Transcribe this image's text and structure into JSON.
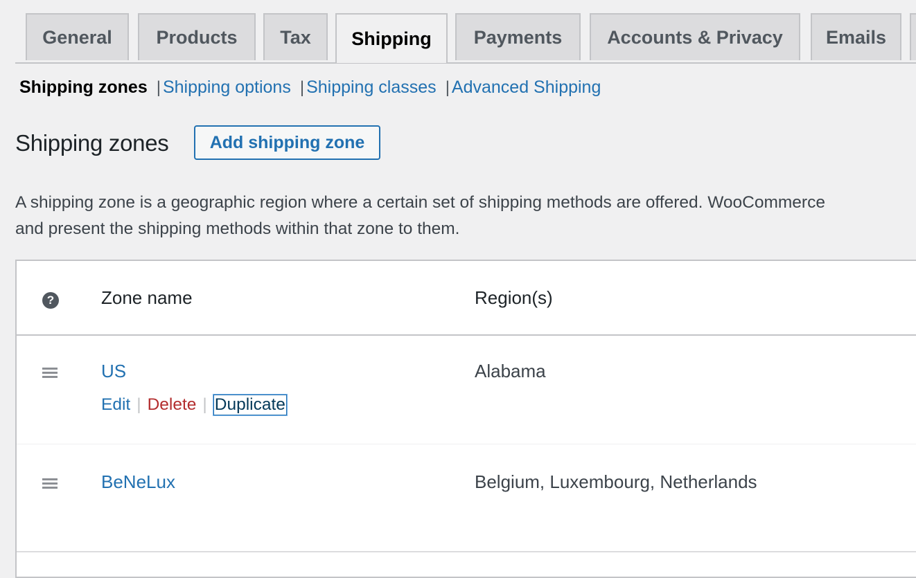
{
  "tabs": [
    {
      "label": "General"
    },
    {
      "label": "Products"
    },
    {
      "label": "Tax"
    },
    {
      "label": "Shipping",
      "active": true
    },
    {
      "label": "Payments"
    },
    {
      "label": "Accounts & Privacy"
    },
    {
      "label": "Emails"
    }
  ],
  "subnav": {
    "current": "Shipping zones",
    "separator": "|",
    "links": [
      "Shipping options",
      "Shipping classes",
      "Advanced Shipping"
    ]
  },
  "heading": {
    "title": "Shipping zones",
    "add_button": "Add shipping zone"
  },
  "description": {
    "line1": "A shipping zone is a geographic region where a certain set of shipping methods are offered. WooCommerce",
    "line2": "and present the shipping methods within that zone to them."
  },
  "table": {
    "help_icon": "question-mark-icon",
    "help_glyph": "?",
    "columns": [
      "Zone name",
      "Region(s)"
    ],
    "rows": [
      {
        "name": "US",
        "region": "Alabama",
        "actions": {
          "edit": "Edit",
          "delete": "Delete",
          "duplicate": "Duplicate",
          "pipe": "|"
        }
      },
      {
        "name": "BeNeLux",
        "region": "Belgium, Luxembourg, Netherlands"
      }
    ]
  },
  "colors": {
    "link": "#2271b1",
    "delete": "#b32d2e",
    "background": "#f0f0f1"
  }
}
